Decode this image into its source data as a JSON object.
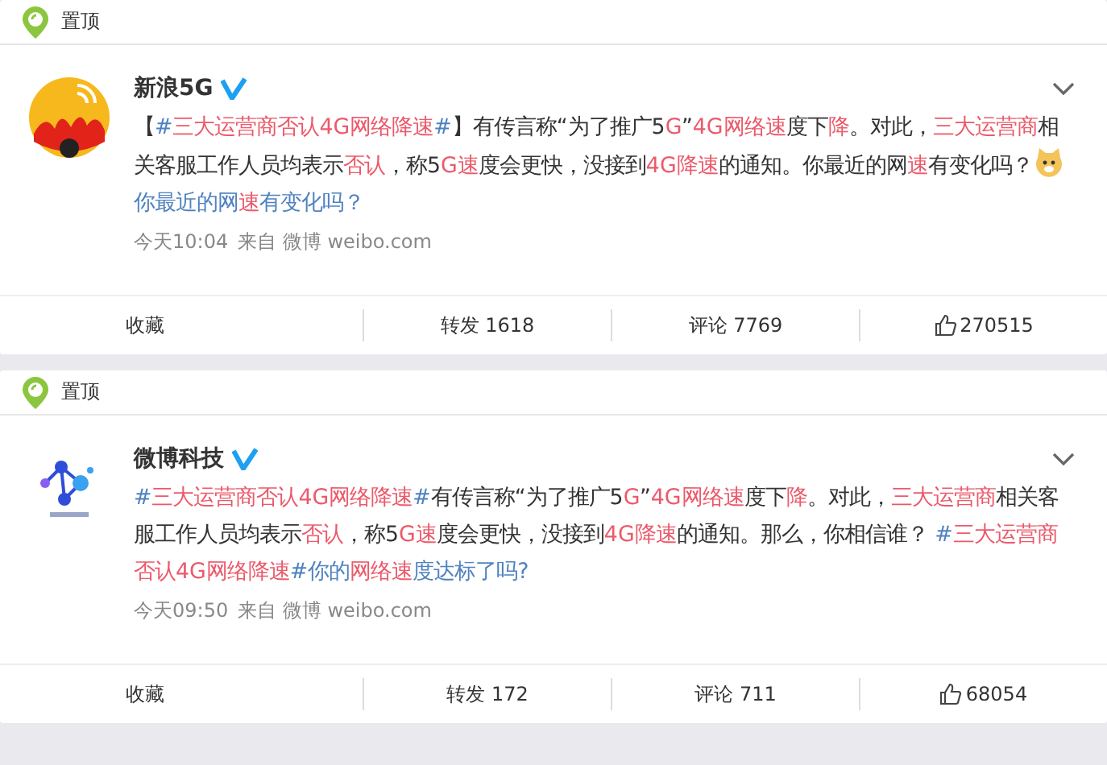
{
  "posts": [
    {
      "pin_label": "置顶",
      "author": "新浪5G",
      "verified": true,
      "avatar": {
        "kind": "sina"
      },
      "segments": [
        {
          "kind": "text",
          "text": "【"
        },
        {
          "kind": "link",
          "text": "#"
        },
        {
          "kind": "highlight",
          "text": "三大运营商否认4G网络降速"
        },
        {
          "kind": "link",
          "text": "#"
        },
        {
          "kind": "text",
          "text": "】有传言称“为了推广5"
        },
        {
          "kind": "highlight",
          "text": "G"
        },
        {
          "kind": "text",
          "text": "”"
        },
        {
          "kind": "highlight",
          "text": "4G网络速"
        },
        {
          "kind": "text",
          "text": "度下"
        },
        {
          "kind": "highlight",
          "text": "降"
        },
        {
          "kind": "text",
          "text": "。对此，"
        },
        {
          "kind": "highlight",
          "text": "三大运营商"
        },
        {
          "kind": "text",
          "text": "相关客服工作人员均表示"
        },
        {
          "kind": "highlight",
          "text": "否认"
        },
        {
          "kind": "text",
          "text": "，称5"
        },
        {
          "kind": "highlight",
          "text": "G速"
        },
        {
          "kind": "text",
          "text": "度会更快，没接到"
        },
        {
          "kind": "highlight",
          "text": "4G降速"
        },
        {
          "kind": "text",
          "text": "的通知。你最近的网"
        },
        {
          "kind": "highlight",
          "text": "速"
        },
        {
          "kind": "text",
          "text": "有变化吗？"
        },
        {
          "kind": "emoji"
        },
        {
          "kind": "link",
          "text": "你最近的网"
        },
        {
          "kind": "highlight",
          "text": "速"
        },
        {
          "kind": "link",
          "text": "有变化吗？"
        }
      ],
      "time": "今天10:04",
      "source": "来自 微博 weibo.com",
      "actions": [
        {
          "kind": "plain",
          "label": "收藏"
        },
        {
          "kind": "plain",
          "label": "转发 1618"
        },
        {
          "kind": "plain",
          "label": "评论 7769"
        },
        {
          "kind": "like",
          "label": "270515"
        }
      ]
    },
    {
      "pin_label": "置顶",
      "author": "微博科技",
      "verified": true,
      "avatar": {
        "kind": "tech"
      },
      "segments": [
        {
          "kind": "link",
          "text": "#"
        },
        {
          "kind": "highlight",
          "text": "三大运营商否认4G网络降速"
        },
        {
          "kind": "link",
          "text": "#"
        },
        {
          "kind": "text",
          "text": "有传言称“为了推广5"
        },
        {
          "kind": "highlight",
          "text": "G"
        },
        {
          "kind": "text",
          "text": "”"
        },
        {
          "kind": "highlight",
          "text": "4G网络速"
        },
        {
          "kind": "text",
          "text": "度下"
        },
        {
          "kind": "highlight",
          "text": "降"
        },
        {
          "kind": "text",
          "text": "。对此，"
        },
        {
          "kind": "highlight",
          "text": "三大运营商"
        },
        {
          "kind": "text",
          "text": "相关客服工作人员均表示"
        },
        {
          "kind": "highlight",
          "text": "否认"
        },
        {
          "kind": "text",
          "text": "，称5"
        },
        {
          "kind": "highlight",
          "text": "G速"
        },
        {
          "kind": "text",
          "text": "度会更快，没接到"
        },
        {
          "kind": "highlight",
          "text": "4G降速"
        },
        {
          "kind": "text",
          "text": "的通知。那么，你相信谁？ "
        },
        {
          "kind": "link",
          "text": "#"
        },
        {
          "kind": "highlight",
          "text": "三大运营商否认4G网络降速"
        },
        {
          "kind": "link",
          "text": "#你的"
        },
        {
          "kind": "highlight",
          "text": "网络速"
        },
        {
          "kind": "link",
          "text": "度达标了吗?"
        }
      ],
      "time": "今天09:50",
      "source": "来自 微博 weibo.com",
      "actions": [
        {
          "kind": "plain",
          "label": "收藏"
        },
        {
          "kind": "plain",
          "label": "转发 172"
        },
        {
          "kind": "plain",
          "label": "评论 711"
        },
        {
          "kind": "like",
          "label": "68054"
        }
      ]
    }
  ]
}
